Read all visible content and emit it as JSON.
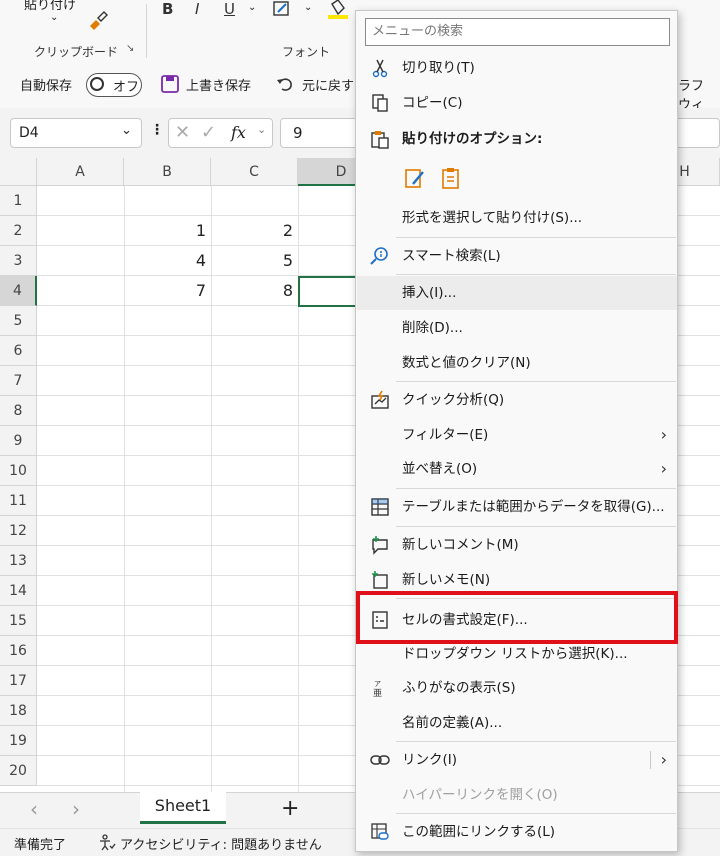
{
  "ribbon": {
    "clipboard_label": "クリップボード",
    "paste_label": "貼り付け",
    "font_label": "フォント",
    "bold": "B",
    "italic": "I",
    "underline": "U"
  },
  "qat": {
    "autosave_label": "自動保存",
    "autosave_state": "オフ",
    "save_label": "上書き保存",
    "undo_label": "元に戻す",
    "right_clip": "ラフ ウィ"
  },
  "formula_bar": {
    "name_box": "D4",
    "fx": "fx",
    "value": "9"
  },
  "grid": {
    "columns": [
      "A",
      "B",
      "C",
      "D",
      "H"
    ],
    "rows": [
      "1",
      "2",
      "3",
      "4",
      "5",
      "6",
      "7",
      "8",
      "9",
      "10",
      "11",
      "12",
      "13",
      "14",
      "15",
      "16",
      "17",
      "18",
      "19",
      "20"
    ],
    "cells": [
      {
        "row": "2",
        "col": "B",
        "value": "1"
      },
      {
        "row": "2",
        "col": "C",
        "value": "2"
      },
      {
        "row": "3",
        "col": "B",
        "value": "4"
      },
      {
        "row": "3",
        "col": "C",
        "value": "5"
      },
      {
        "row": "4",
        "col": "B",
        "value": "7"
      },
      {
        "row": "4",
        "col": "C",
        "value": "8"
      }
    ]
  },
  "sheet_tabs": {
    "prev": "‹",
    "next": "›",
    "active": "Sheet1",
    "add": "+"
  },
  "status": {
    "ready": "準備完了",
    "accessibility": "アクセシビリティ: 問題ありません"
  },
  "context_menu": {
    "search_placeholder": "メニューの検索",
    "cut": "切り取り(T)",
    "copy": "コピー(C)",
    "paste_options": "貼り付けのオプション:",
    "paste_special": "形式を選択して貼り付け(S)...",
    "smart_lookup": "スマート検索(L)",
    "insert": "挿入(I)...",
    "delete": "削除(D)...",
    "clear_contents": "数式と値のクリア(N)",
    "quick_analysis": "クイック分析(Q)",
    "filter": "フィルター(E)",
    "sort": "並べ替え(O)",
    "get_data": "テーブルまたは範囲からデータを取得(G)...",
    "new_comment": "新しいコメント(M)",
    "new_note": "新しいメモ(N)",
    "format_cells": "セルの書式設定(F)...",
    "dropdown_pick": "ドロップダウン リストから選択(K)...",
    "phonetic": "ふりがなの表示(S)",
    "define_name": "名前の定義(A)...",
    "link": "リンク(I)",
    "open_hyperlink": "ハイパーリンクを開く(O)",
    "link_to_range": "この範囲にリンクする(L)"
  },
  "colors": {
    "highlight": "#e0101b",
    "selection": "#217346",
    "accent_blue": "#1e6fc6",
    "accent_orange": "#e07b00"
  }
}
